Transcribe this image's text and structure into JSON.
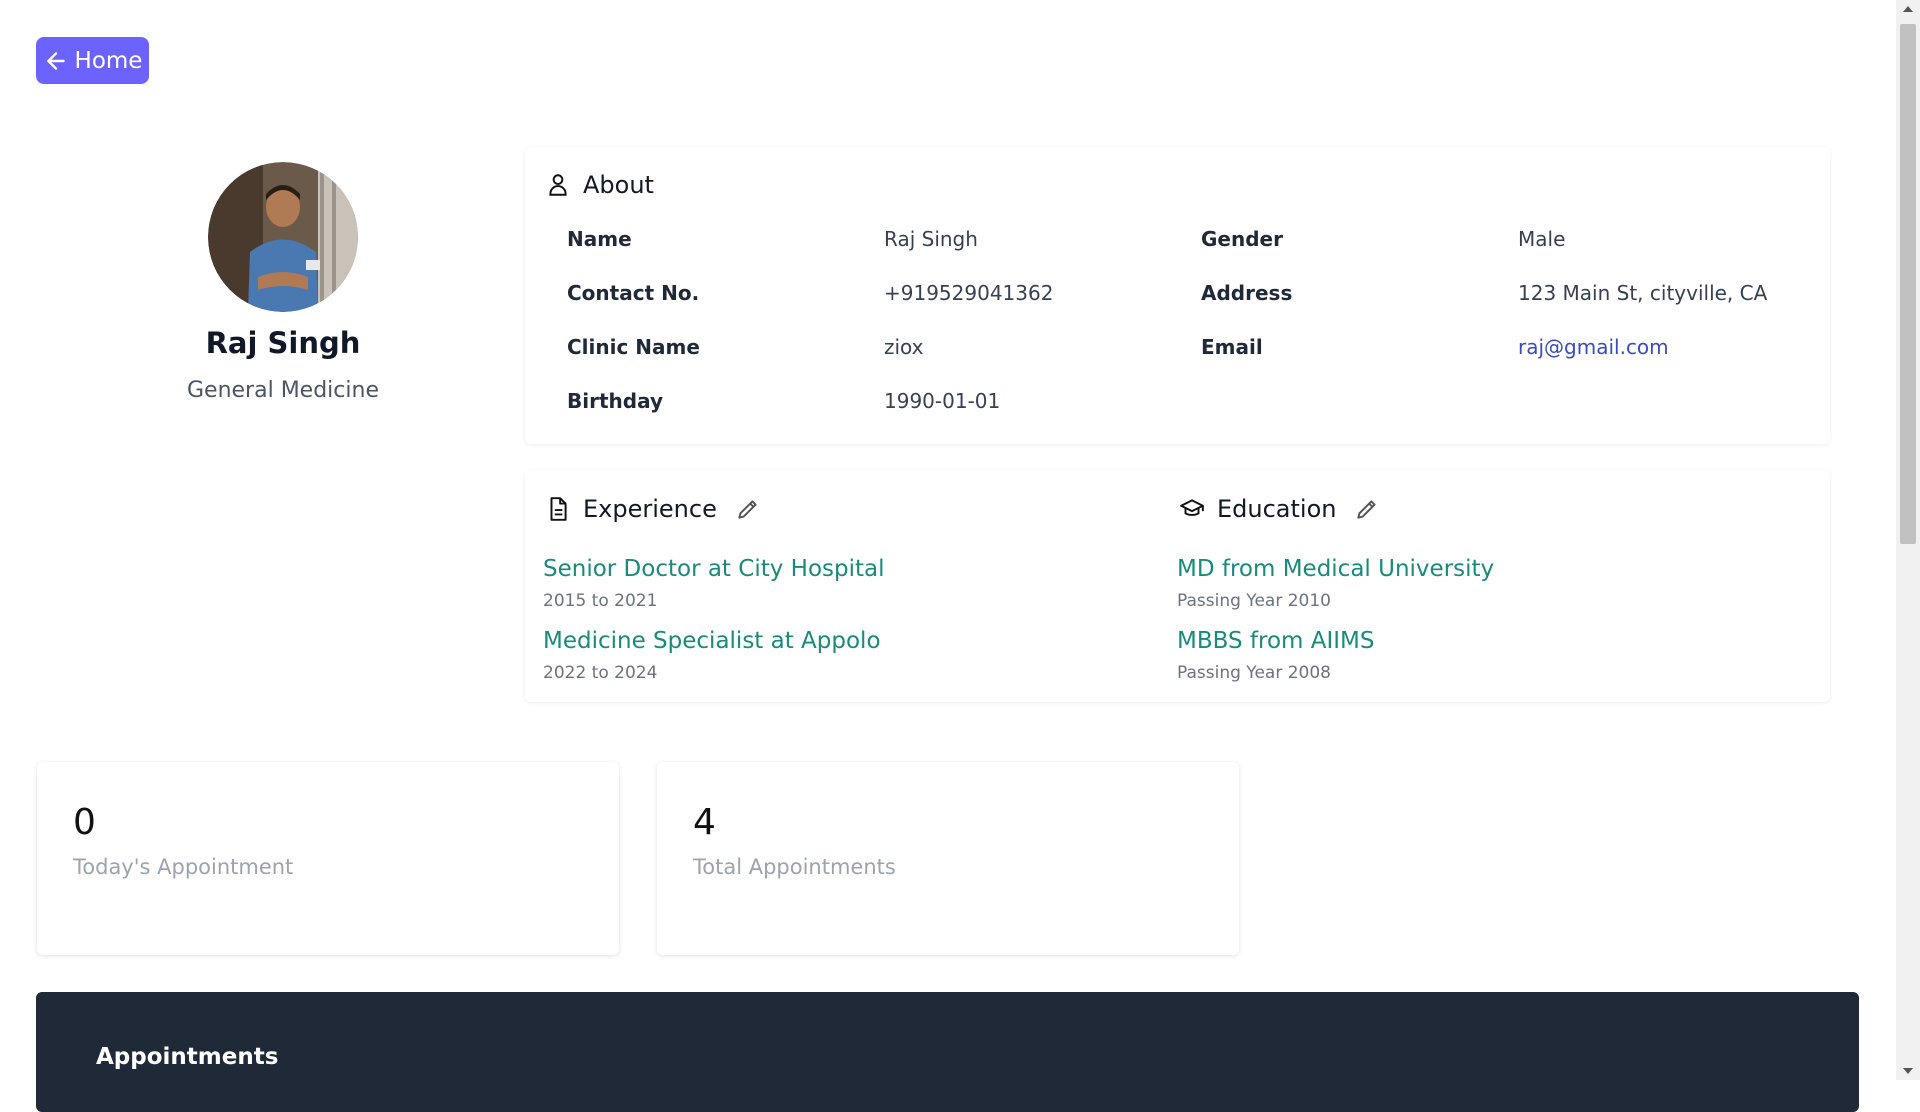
{
  "nav": {
    "home_label": "Home"
  },
  "profile": {
    "name": "Raj Singh",
    "specialty": "General Medicine"
  },
  "about": {
    "title": "About",
    "fields": [
      {
        "label": "Name",
        "value": "Raj Singh"
      },
      {
        "label": "Gender",
        "value": "Male"
      },
      {
        "label": "Contact No.",
        "value": "+919529041362"
      },
      {
        "label": "Address",
        "value": "123 Main St, cityville, CA"
      },
      {
        "label": "Clinic Name",
        "value": "ziox"
      },
      {
        "label": "Email",
        "value": "raj@gmail.com"
      },
      {
        "label": "Birthday",
        "value": "1990-01-01"
      }
    ]
  },
  "experience": {
    "title": "Experience",
    "items": [
      {
        "title": "Senior Doctor at City Hospital",
        "sub": "2015 to 2021"
      },
      {
        "title": "Medicine Specialist at Appolo",
        "sub": "2022 to 2024"
      }
    ]
  },
  "education": {
    "title": "Education",
    "items": [
      {
        "title": "MD from Medical University",
        "sub": "Passing Year 2010"
      },
      {
        "title": "MBBS from AIIMS",
        "sub": "Passing Year 2008"
      }
    ]
  },
  "stats": [
    {
      "value": "0",
      "label": "Today's Appointment"
    },
    {
      "value": "4",
      "label": "Total Appointments"
    }
  ],
  "appointments": {
    "title": "Appointments"
  },
  "colors": {
    "accent": "#6c63ff",
    "link": "#1a8a7a",
    "email": "#3b4cb8",
    "dark_panel": "#1f2937"
  }
}
